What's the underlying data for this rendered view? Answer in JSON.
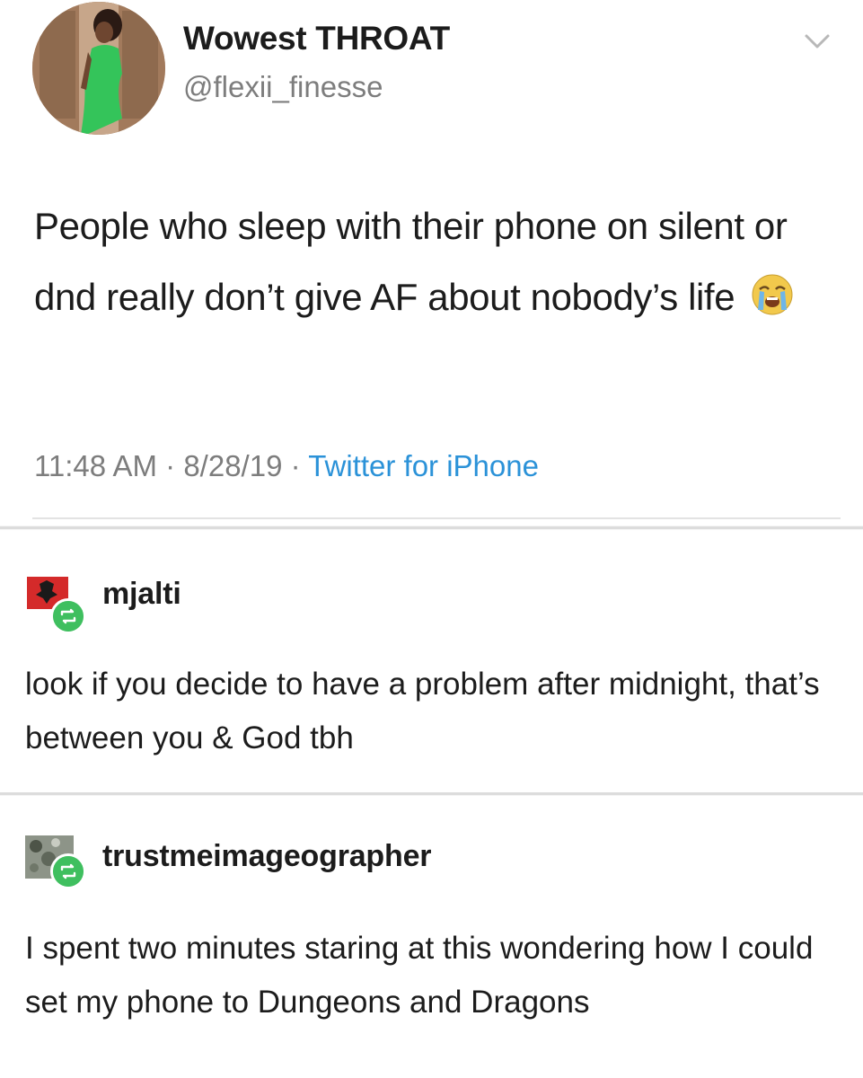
{
  "tweet": {
    "display_name": "Wowest THROAT",
    "handle": "@flexii_finesse",
    "text": "People who sleep with their phone on silent or dnd really don’t give AF about nobody’s life",
    "emoji_icon": "loudly-crying-face-emoji",
    "time": "11:48 AM",
    "date": "8/28/19",
    "separator": "·",
    "source": "Twitter for iPhone",
    "colors": {
      "source_link": "#2b92d8",
      "muted": "#7d7d7d",
      "dress": "#34c45a"
    }
  },
  "posts": [
    {
      "username": "mjalti",
      "avatar_icon": "albania-flag-avatar",
      "badge_icon": "reblog-icon",
      "text": "look if you decide to have a problem after midnight, that’s between you & God tbh"
    },
    {
      "username": "trustmeimageographer",
      "avatar_icon": "satellite-terrain-avatar",
      "badge_icon": "reblog-icon",
      "text": "I spent two minutes staring at this wondering how I could set my phone to Dungeons and Dragons"
    }
  ],
  "colors": {
    "reblog_badge": "#3fbf5f",
    "background": "#ffffff"
  }
}
